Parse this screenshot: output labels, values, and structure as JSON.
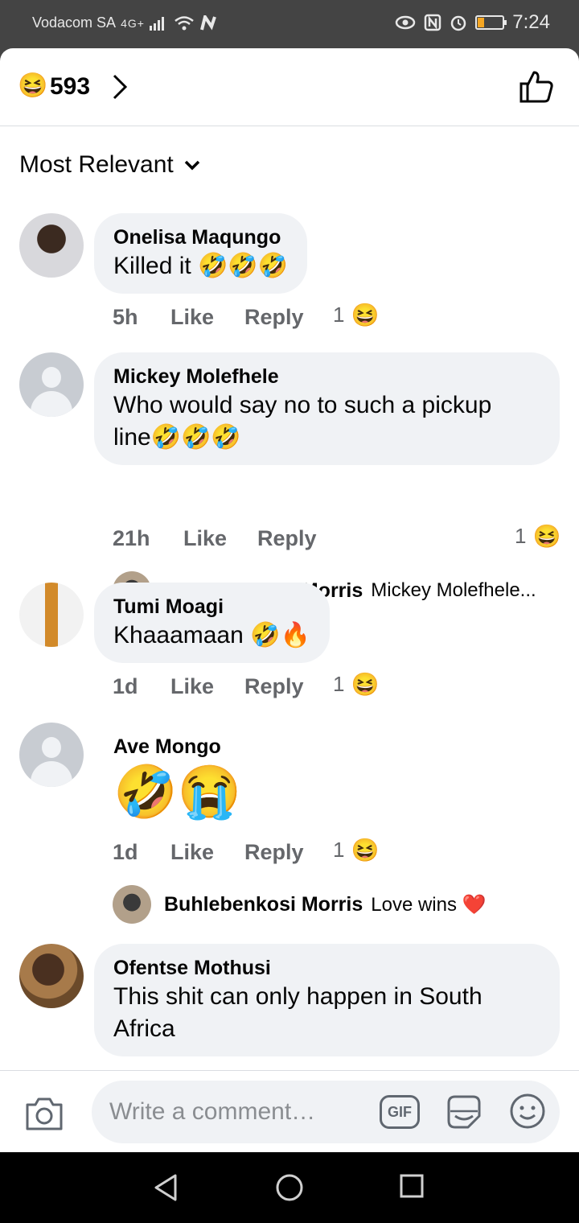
{
  "status_bar": {
    "carrier": "Vodacom SA",
    "network": "4G+",
    "time": "7:24"
  },
  "reactions": {
    "emoji": "😆",
    "count": "593"
  },
  "sort": {
    "label": "Most Relevant"
  },
  "comments": [
    {
      "name": "Onelisa Maqungo",
      "text": "Killed it 🤣🤣🤣",
      "time": "5h",
      "like": "Like",
      "reply": "Reply",
      "reaction_count": "1",
      "reaction_emoji": "😆"
    },
    {
      "name": "Mickey Molefhele",
      "text_line1": "Who would say no to such a pickup",
      "text_line2": "line🤣🤣🤣",
      "time": "21h",
      "like": "Like",
      "reply": "Reply",
      "reaction_count": "1",
      "reaction_emoji": "😆",
      "reply_preview": {
        "name": "Buhlebenkosi Morris",
        "text": "Mickey Molefhele..."
      }
    },
    {
      "name": "Tumi Moagi",
      "text": "Khaaamaan 🤣🔥",
      "time": "1d",
      "like": "Like",
      "reply": "Reply",
      "reaction_count": "1",
      "reaction_emoji": "😆"
    },
    {
      "name": "Ave Mongo",
      "text": "🤣😭",
      "time": "1d",
      "like": "Like",
      "reply": "Reply",
      "reaction_count": "1",
      "reaction_emoji": "😆",
      "reply_preview": {
        "name": "Buhlebenkosi Morris",
        "text": "Love wins ❤️"
      }
    },
    {
      "name": "Ofentse Mothusi",
      "text_line1": "This shit can only happen in South",
      "text_line2": "Africa"
    }
  ],
  "composer": {
    "placeholder": "Write a comment…",
    "gif_label": "GIF"
  },
  "icons": [
    "chevron-right-icon",
    "thumbs-up-icon",
    "chevron-down-icon",
    "camera-icon",
    "gif-icon",
    "sticker-icon",
    "smiley-icon",
    "back-icon",
    "home-icon",
    "recents-icon"
  ]
}
